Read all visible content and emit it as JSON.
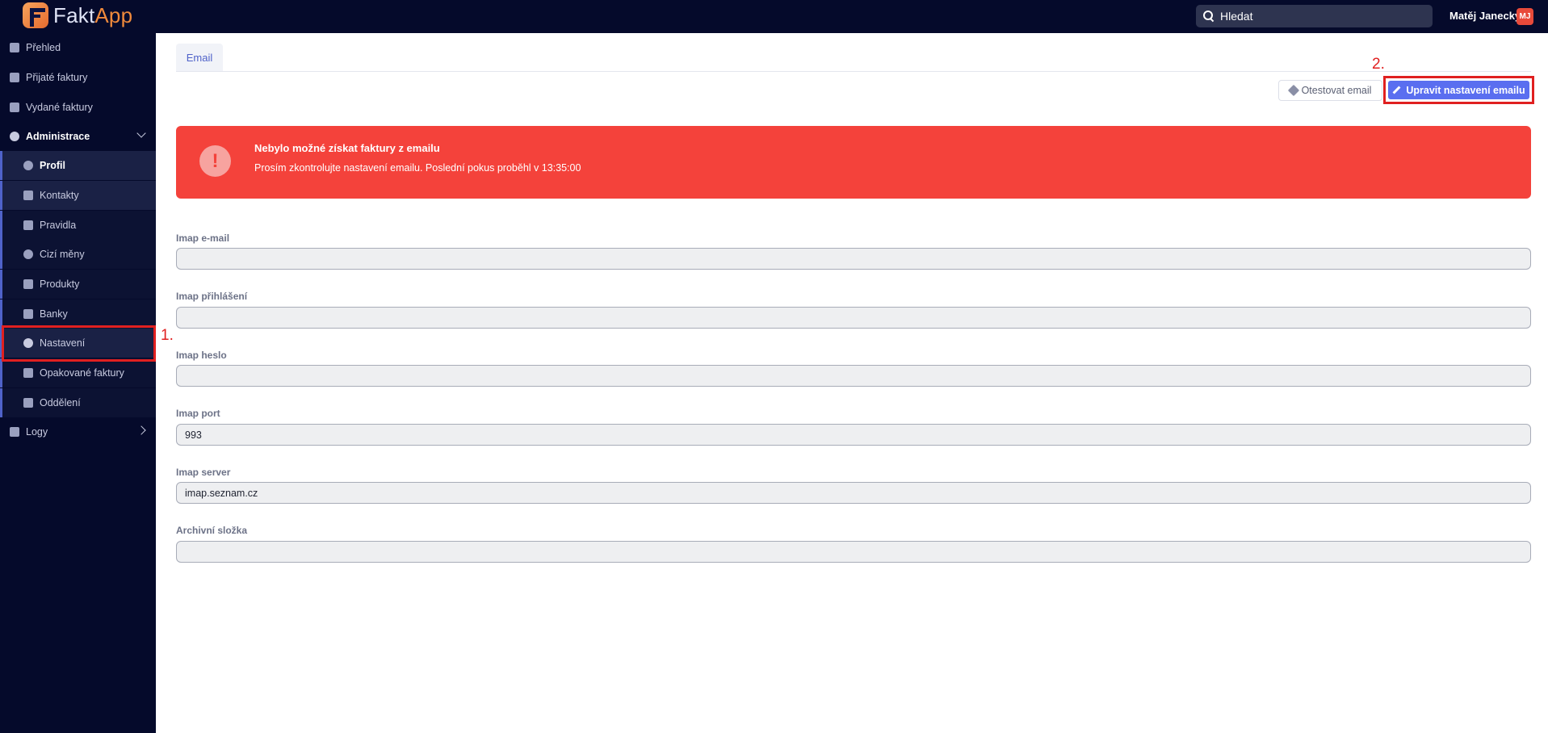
{
  "app": {
    "name_part1": "Fakt",
    "name_part2": "App"
  },
  "search": {
    "placeholder": "Hledat"
  },
  "user": {
    "name": "Matěj Janecký",
    "initials": "MJ"
  },
  "sidebar": {
    "items": [
      {
        "label": "Přehled",
        "icon": "chart-icon"
      },
      {
        "label": "Přijaté faktury",
        "icon": "document-icon"
      },
      {
        "label": "Vydané faktury",
        "icon": "document-icon"
      },
      {
        "label": "Administrace",
        "icon": "gears-icon"
      },
      {
        "label": "Profil",
        "icon": "user-circle-icon"
      },
      {
        "label": "Kontakty",
        "icon": "contacts-icon"
      },
      {
        "label": "Pravidla",
        "icon": "table-icon"
      },
      {
        "label": "Cizí měny",
        "icon": "coin-icon"
      },
      {
        "label": "Produkty",
        "icon": "box-icon"
      },
      {
        "label": "Banky",
        "icon": "bank-icon"
      },
      {
        "label": "Nastavení",
        "icon": "gears-icon"
      },
      {
        "label": "Opakované faktury",
        "icon": "calendar-icon"
      },
      {
        "label": "Oddělení",
        "icon": "building-icon"
      },
      {
        "label": "Logy",
        "icon": "table-icon"
      }
    ]
  },
  "annotations": {
    "step1": "1.",
    "step2": "2."
  },
  "tabs": [
    {
      "label": "Email"
    }
  ],
  "toolbar": {
    "test_label": "Otestovat email",
    "edit_label": "Upravit nastavení emailu"
  },
  "alert": {
    "title": "Nebylo možné získat faktury z emailu",
    "text": "Prosím zkontrolujte nastavení emailu. Poslední pokus proběhl v 13:35:00",
    "icon": "!"
  },
  "form": {
    "fields": [
      {
        "label": "Imap e-mail",
        "value": ""
      },
      {
        "label": "Imap přihlášení",
        "value": ""
      },
      {
        "label": "Imap heslo",
        "value": ""
      },
      {
        "label": "Imap port",
        "value": "993"
      },
      {
        "label": "Imap server",
        "value": "imap.seznam.cz"
      },
      {
        "label": "Archivní složka",
        "value": ""
      }
    ]
  },
  "colors": {
    "sidebar_bg": "#050a2b",
    "accent": "#5a6ef0",
    "alert_bg": "#f4423b",
    "annotation": "#e02020"
  }
}
